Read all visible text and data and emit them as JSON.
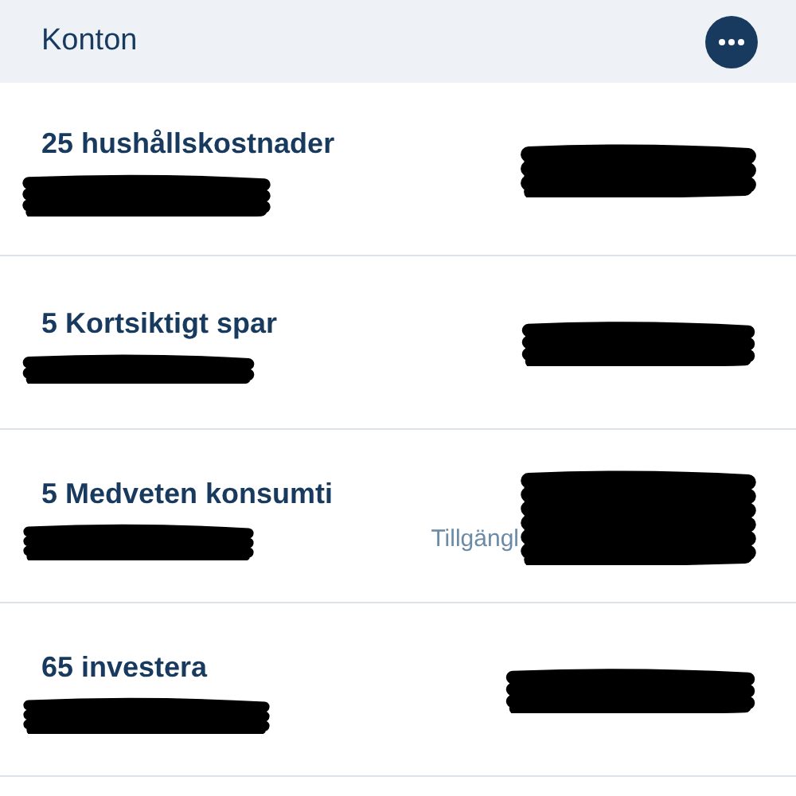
{
  "header": {
    "title": "Konton"
  },
  "accounts": [
    {
      "name": "25 hushållskostnader"
    },
    {
      "name": "5 Kortsiktigt spar"
    },
    {
      "name": "5 Medveten konsumti",
      "caption": "Tillgängl"
    },
    {
      "name": "65 investera"
    }
  ]
}
